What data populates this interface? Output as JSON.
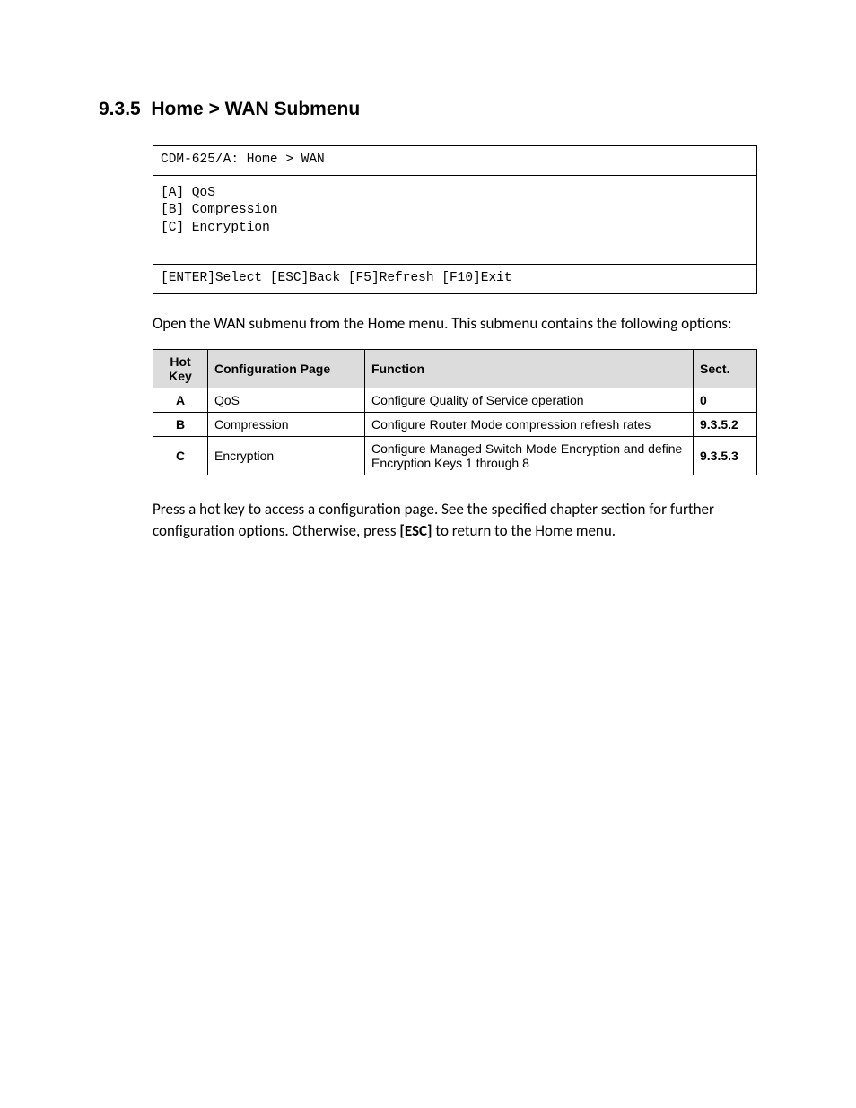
{
  "heading_number": "9.3.5",
  "heading_title": "Home > WAN Submenu",
  "terminal": {
    "title": "CDM-625/A:  Home > WAN",
    "lines": [
      "[A]  QoS",
      "[B]  Compression",
      "[C]  Encryption"
    ],
    "footer": "[ENTER]Select [ESC]Back [F5]Refresh [F10]Exit"
  },
  "intro": "Open the WAN submenu from the Home menu. This submenu contains the following options:",
  "table": {
    "headers": {
      "hotkey_line1": "Hot",
      "hotkey_line2": "Key",
      "config": "Configuration Page",
      "function": "Function",
      "sect": "Sect."
    },
    "rows": [
      {
        "hotkey": "A",
        "config": "QoS",
        "function": "Configure Quality of Service operation",
        "sect": "0"
      },
      {
        "hotkey": "B",
        "config": "Compression",
        "function": "Configure Router Mode compression refresh rates",
        "sect": "9.3.5.2"
      },
      {
        "hotkey": "C",
        "config": "Encryption",
        "function": "Configure Managed Switch Mode Encryption and define Encryption Keys 1 through 8",
        "sect": "9.3.5.3"
      }
    ]
  },
  "outro": {
    "part1": "Press a hot key to access a configuration page. See the specified chapter section for further configuration options. Otherwise, press ",
    "esc": "[ESC]",
    "part2": " to return to the Home menu."
  }
}
